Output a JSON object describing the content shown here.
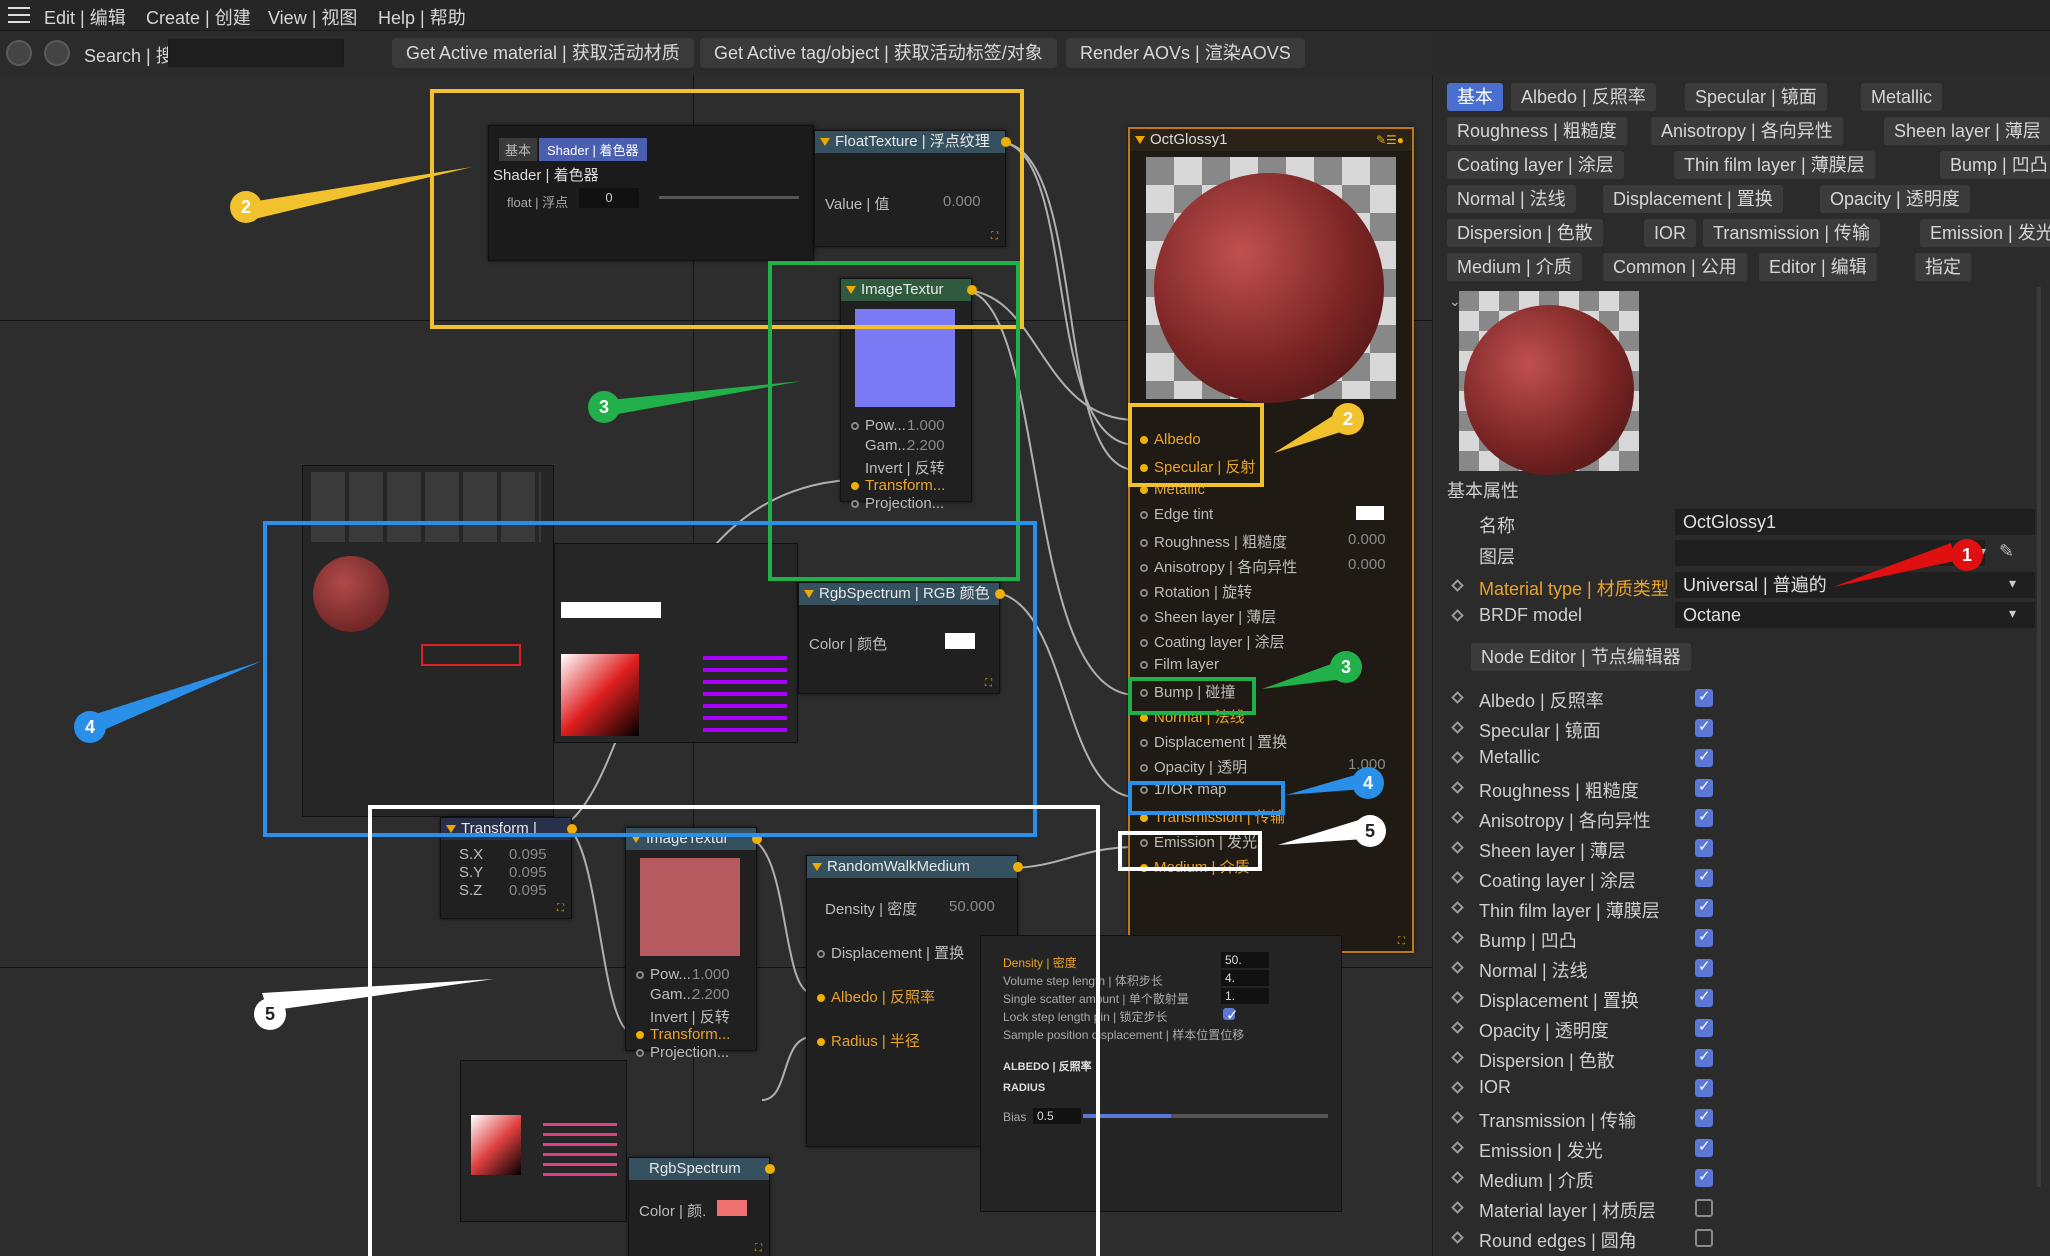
{
  "menu": {
    "items": [
      "Edit | 编辑",
      "Create | 创建",
      "View | 视图",
      "Help | 帮助"
    ]
  },
  "toolbar": {
    "search_label": "Search | 搜",
    "search_value": "",
    "btn_material": "Get Active material | 获取活动材质",
    "btn_tag": "Get Active tag/object | 获取活动标签/对象",
    "btn_render": "Render AOVs | 渲染AOVS"
  },
  "nodes": {
    "shader_mini": {
      "tab_basic": "基本",
      "tab_shader": "Shader | 着色器",
      "title": "Shader | 着色器",
      "float_label": "float | 浮点",
      "float_value": "0"
    },
    "float_texture": {
      "title": "FloatTexture | 浮点纹理",
      "value_label": "Value | 值",
      "value": "0.000"
    },
    "image_texture_1": {
      "title": "ImageTextur",
      "power_label": "Pow...",
      "power": "1.000",
      "gamma_label": "Gam...",
      "gamma": "2.200",
      "invert_label": "Invert | 反转",
      "transform_label": "Transform...",
      "projection_label": "Projection..."
    },
    "rgb_spectrum_1": {
      "title": "RgbSpectrum | RGB 颜色",
      "color_label": "Color | 颜色"
    },
    "octglossy": {
      "title": "OctGlossy1",
      "inputs": [
        {
          "label": "Albedo",
          "orange": true,
          "value": ""
        },
        {
          "label": "Specular | 反射",
          "orange": true,
          "value": ""
        },
        {
          "label": "Metallic",
          "orange": true,
          "value": ""
        },
        {
          "label": "Edge tint",
          "orange": false,
          "value": ""
        },
        {
          "label": "Roughness | 粗糙度",
          "orange": false,
          "value": "0.000"
        },
        {
          "label": "Anisotropy | 各向异性",
          "orange": false,
          "value": "0.000"
        },
        {
          "label": "Rotation | 旋转",
          "orange": false,
          "value": ""
        },
        {
          "label": "Sheen layer | 薄层",
          "orange": false,
          "value": ""
        },
        {
          "label": "Coating layer | 涂层",
          "orange": false,
          "value": ""
        },
        {
          "label": "Film layer",
          "orange": false,
          "value": ""
        },
        {
          "label": "Bump | 碰撞",
          "orange": false,
          "value": ""
        },
        {
          "label": "Normal | 法线",
          "orange": true,
          "value": ""
        },
        {
          "label": "Displacement | 置换",
          "orange": false,
          "value": ""
        },
        {
          "label": "Opacity | 透明",
          "orange": false,
          "value": "1.000"
        },
        {
          "label": "1/IOR map",
          "orange": false,
          "value": ""
        },
        {
          "label": "Transmission | 传输",
          "orange": true,
          "value": ""
        },
        {
          "label": "Emission | 发光",
          "orange": false,
          "value": ""
        },
        {
          "label": "Medium | 介质",
          "orange": true,
          "value": ""
        }
      ]
    },
    "transform": {
      "title": "Transform |",
      "sx_label": "S.X",
      "sx": "0.095",
      "sy_label": "S.Y",
      "sy": "0.095",
      "sz_label": "S.Z",
      "sz": "0.095"
    },
    "image_texture_2": {
      "title": "ImageTextur",
      "power_label": "Pow...",
      "power": "1.000",
      "gamma_label": "Gam...",
      "gamma": "2.200",
      "invert_label": "Invert | 反转",
      "transform_label": "Transform...",
      "projection_label": "Projection..."
    },
    "random_walk": {
      "title": "RandomWalkMedium",
      "density_label": "Density | 密度",
      "density": "50.000",
      "displacement_label": "Displacement | 置换",
      "albedo_label": "Albedo | 反照率",
      "radius_label": "Radius | 半径"
    },
    "rgb_spectrum_2": {
      "title": "RgbSpectrum",
      "color_label": "Color | 颜."
    },
    "medium_panel": {
      "density_label": "Density | 密度",
      "density": "50.",
      "volume_step_label": "Volume step length | 体积步长",
      "volume_step": "4.",
      "single_scatter_label": "Single scatter amount | 单个散射量",
      "single_scatter": "1.",
      "lock_step_label": "Lock step length pin | 锁定步长",
      "sample_pos_label": "Sample position displacement | 样本位置位移",
      "albedo_section": "ALBEDO | 反照率",
      "radius_section": "RADIUS",
      "bias_label": "Bias",
      "bias": "0.5"
    }
  },
  "callouts": {
    "c1": "1",
    "c2a": "2",
    "c2b": "2",
    "c3a": "3",
    "c3b": "3",
    "c4a": "4",
    "c4b": "4",
    "c5a": "5",
    "c5b": "5"
  },
  "panel": {
    "tabs": [
      "基本",
      "Albedo | 反照率",
      "Specular | 镜面",
      "Metallic",
      "Roughness | 粗糙度",
      "Anisotropy | 各向异性",
      "Sheen layer | 薄层",
      "Coating layer | 涂层",
      "Thin film layer | 薄膜层",
      "Bump | 凹凸",
      "Normal | 法线",
      "Displacement | 置换",
      "Opacity | 透明度",
      "Dispersion | 色散",
      "IOR",
      "Transmission | 传输",
      "Emission | 发光",
      "Medium | 介质",
      "Common | 公用",
      "Editor | 编辑",
      "指定"
    ],
    "section_title": "基本属性",
    "name_label": "名称",
    "name_value": "OctGlossy1",
    "layer_label": "图层",
    "layer_value": "",
    "material_type_label": "Material type | 材质类型",
    "material_type_value": "Universal | 普遍的",
    "brdf_label": "BRDF model",
    "brdf_value": "Octane",
    "node_editor_label": "Node Editor | 节点编辑器",
    "channels": [
      {
        "label": "Albedo | 反照率",
        "checked": true
      },
      {
        "label": "Specular | 镜面",
        "checked": true
      },
      {
        "label": "Metallic",
        "checked": true
      },
      {
        "label": "Roughness | 粗糙度",
        "checked": true
      },
      {
        "label": "Anisotropy | 各向异性",
        "checked": true
      },
      {
        "label": "Sheen layer | 薄层",
        "checked": true
      },
      {
        "label": "Coating layer | 涂层",
        "checked": true
      },
      {
        "label": "Thin film layer | 薄膜层",
        "checked": true
      },
      {
        "label": "Bump | 凹凸",
        "checked": true
      },
      {
        "label": "Normal | 法线",
        "checked": true
      },
      {
        "label": "Displacement | 置换",
        "checked": true
      },
      {
        "label": "Opacity | 透明度",
        "checked": true
      },
      {
        "label": "Dispersion | 色散",
        "checked": true
      },
      {
        "label": "IOR",
        "checked": true
      },
      {
        "label": "Transmission | 传输",
        "checked": true
      },
      {
        "label": "Emission | 发光",
        "checked": true
      },
      {
        "label": "Medium | 介质",
        "checked": true
      },
      {
        "label": "Material layer | 材质层",
        "checked": false
      },
      {
        "label": "Round edges | 圆角",
        "checked": false
      }
    ]
  },
  "colors": {
    "accent_blue": "#4a6fcf",
    "highlight_yellow": "#f2c12e",
    "highlight_green": "#22b04b",
    "highlight_blue": "#2a8fe8",
    "highlight_white": "#ffffff",
    "callout_red": "#e01010",
    "port_orange": "#f0b000"
  }
}
